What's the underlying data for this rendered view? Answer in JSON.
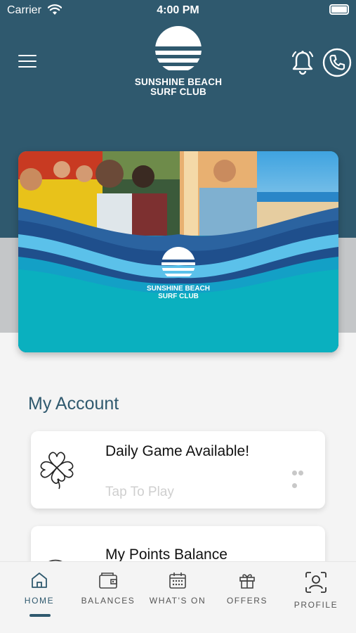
{
  "status_bar": {
    "carrier": "Carrier",
    "time": "4:00 PM"
  },
  "header": {
    "logo_line1": "SUNSHINE BEACH",
    "logo_line2": "SURF CLUB",
    "menu_icon": "hamburger-menu-icon",
    "bell_icon": "bell-icon",
    "phone_icon": "phone-icon"
  },
  "hero_card": {
    "logo_line1": "SUNSHINE BEACH",
    "logo_line2": "SURF CLUB"
  },
  "section": {
    "title": "My Account"
  },
  "tiles": [
    {
      "title": "Daily Game Available!",
      "subtitle": "Tap To Play",
      "icon": "clover-icon"
    },
    {
      "title": "My Points Balance",
      "icon": "fingerprint-icon"
    }
  ],
  "tabbar": {
    "tabs": [
      {
        "label": "HOME",
        "icon": "home-icon",
        "active": true
      },
      {
        "label": "BALANCES",
        "icon": "wallet-icon"
      },
      {
        "label": "WHAT'S ON",
        "icon": "calendar-icon"
      },
      {
        "label": "OFFERS",
        "icon": "gift-icon"
      },
      {
        "label": "PROFILE",
        "icon": "profile-icon"
      }
    ]
  },
  "colors": {
    "primary": "#2f596e",
    "teal": "#0ab0bf",
    "background": "#f4f4f4"
  }
}
